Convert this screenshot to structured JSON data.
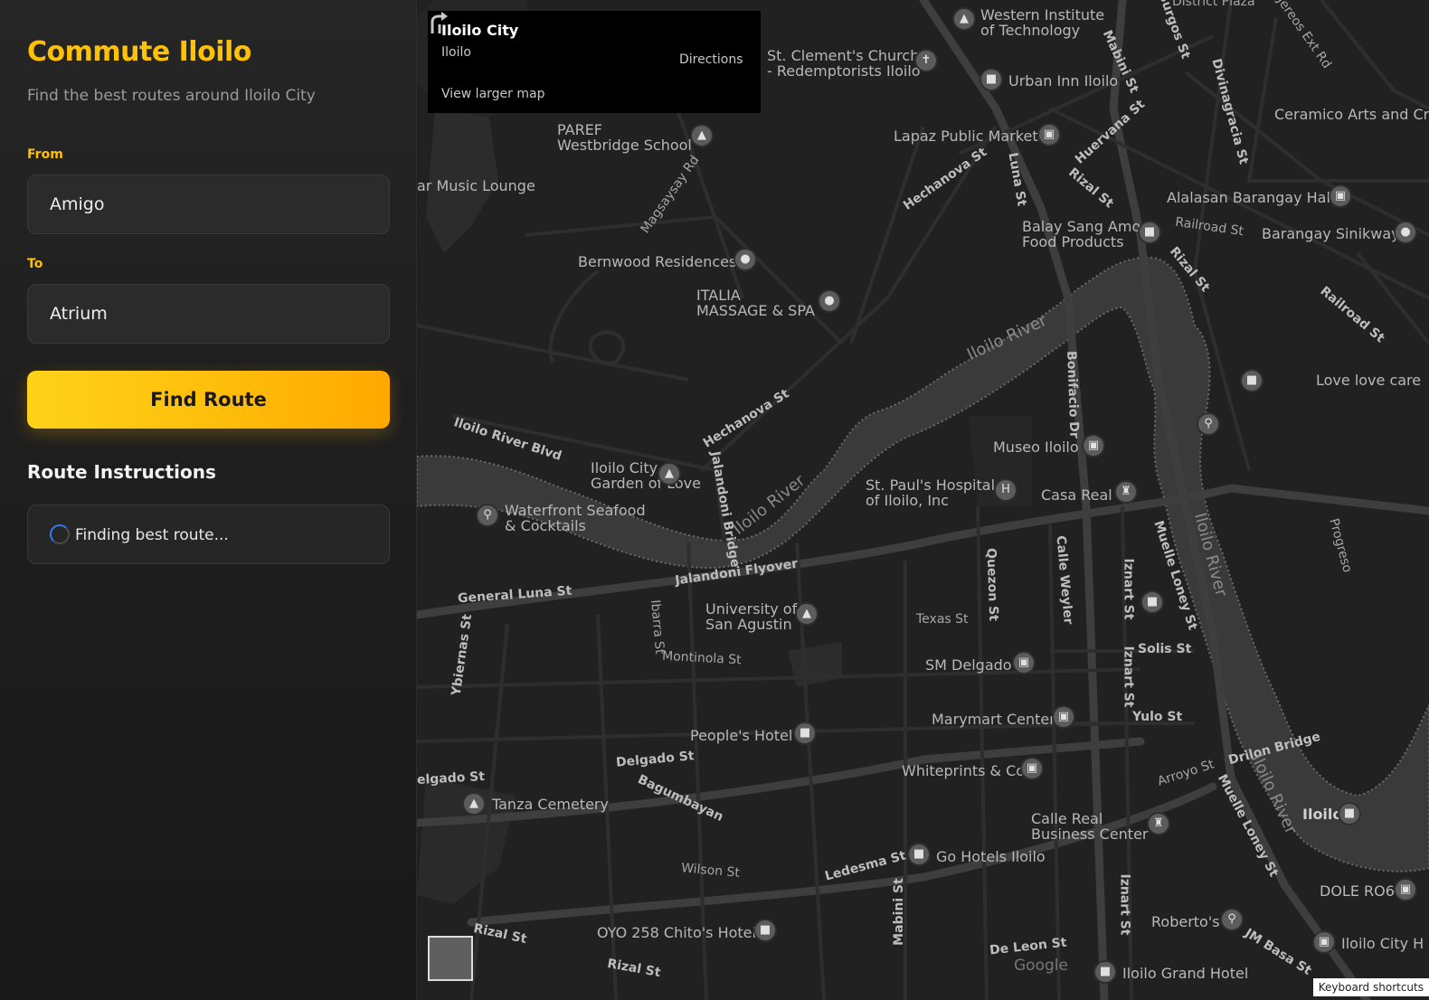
{
  "app": {
    "title": "Commute Iloilo",
    "subtitle": "Find the best routes around Iloilo City"
  },
  "form": {
    "from_label": "From",
    "from_value": "Amigo",
    "to_label": "To",
    "to_value": "Atrium",
    "find_button": "Find Route"
  },
  "route": {
    "section_title": "Route Instructions",
    "status": "Finding best route..."
  },
  "map": {
    "card": {
      "place_name": "Iloilo City",
      "place_region": "Iloilo",
      "directions": "Directions",
      "larger_map": "View larger map"
    },
    "labels": [
      {
        "text": "Western Institute\nof Technology"
      },
      {
        "text": "St. Clement's Church\n- Redemptorists Iloilo"
      },
      {
        "text": "Urban Inn Iloilo"
      },
      {
        "text": "Lapaz Public Market"
      },
      {
        "text": "PAREF\nWestbridge School"
      },
      {
        "text": "ar Music Lounge"
      },
      {
        "text": "Bernwood Residences"
      },
      {
        "text": "ITALIA\nMASSAGE & SPA"
      },
      {
        "text": "Ceramico Arts and Cr"
      },
      {
        "text": "Alalasan Barangay Hall"
      },
      {
        "text": "Balay Sang Amo\nFood Products"
      },
      {
        "text": "Barangay Sinikway"
      },
      {
        "text": "Love love care"
      },
      {
        "text": "Museo Iloilo"
      },
      {
        "text": "St. Paul's Hospital\nof Iloilo, Inc"
      },
      {
        "text": "Casa Real"
      },
      {
        "text": "Iloilo City\nGarden of Love"
      },
      {
        "text": "Waterfront Seafood\n& Cocktails"
      },
      {
        "text": "University of\nSan Agustin"
      },
      {
        "text": "SM Delgado"
      },
      {
        "text": "Marymart Center"
      },
      {
        "text": "People's Hotel"
      },
      {
        "text": "Whiteprints & Co"
      },
      {
        "text": "Tanza Cemetery"
      },
      {
        "text": "Calle Real\nBusiness Center"
      },
      {
        "text": "Go Hotels Iloilo"
      },
      {
        "text": "OYO 258 Chito's Hotel"
      },
      {
        "text": "Roberto's"
      },
      {
        "text": "Iloilo Grand Hotel"
      },
      {
        "text": "Iloilo City H"
      },
      {
        "text": "DOLE RO6"
      },
      {
        "text": "Iloilo"
      }
    ],
    "roads": [
      {
        "text": "General Luna St"
      },
      {
        "text": "Jalandoni Flyover"
      },
      {
        "text": "Iloilo River Blvd"
      },
      {
        "text": "Hechanova St"
      },
      {
        "text": "Hechanova St"
      },
      {
        "text": "Jalandoni Bridge"
      },
      {
        "text": "Delgado St"
      },
      {
        "text": "Ledesma St"
      },
      {
        "text": "Rizal St"
      },
      {
        "text": "Rizal St"
      },
      {
        "text": "Bagumbayan"
      },
      {
        "text": "Wilson St"
      },
      {
        "text": "Montinola St"
      },
      {
        "text": "Texas St"
      },
      {
        "text": "Solis St"
      },
      {
        "text": "Yulo St"
      },
      {
        "text": "Drilon Bridge"
      },
      {
        "text": "Arroyo St"
      },
      {
        "text": "De Leon St"
      },
      {
        "text": "Luna St"
      },
      {
        "text": "Huervana St"
      },
      {
        "text": "Bonifacio Dr"
      },
      {
        "text": "Quezon St"
      },
      {
        "text": "Calle Weyler"
      },
      {
        "text": "Iznart St"
      },
      {
        "text": "Iznart St"
      },
      {
        "text": "Iznart St"
      },
      {
        "text": "Muelle Loney St"
      },
      {
        "text": "Muelle Loney St"
      },
      {
        "text": "Mabini St"
      },
      {
        "text": "Mabini St"
      },
      {
        "text": "Burgos St"
      },
      {
        "text": "Divinagracia St"
      },
      {
        "text": "Rizal St"
      },
      {
        "text": "Rizal St"
      },
      {
        "text": "Railroad St"
      },
      {
        "text": "Railroad St"
      },
      {
        "text": "Ybiernas St"
      },
      {
        "text": "Ibarra St"
      },
      {
        "text": "Magsaysay Rd"
      },
      {
        "text": "JM Basa St"
      },
      {
        "text": "Jereos Ext Rd"
      },
      {
        "text": "District Plaza"
      },
      {
        "text": "Progreso"
      },
      {
        "text": "elgado St"
      }
    ],
    "rivers": [
      {
        "text": "Iloilo River"
      },
      {
        "text": "Iloilo River"
      },
      {
        "text": "Iloilo River"
      },
      {
        "text": "Iloilo River"
      }
    ],
    "google": "Google",
    "keyboard_shortcuts": "Keyboard shortcuts"
  }
}
